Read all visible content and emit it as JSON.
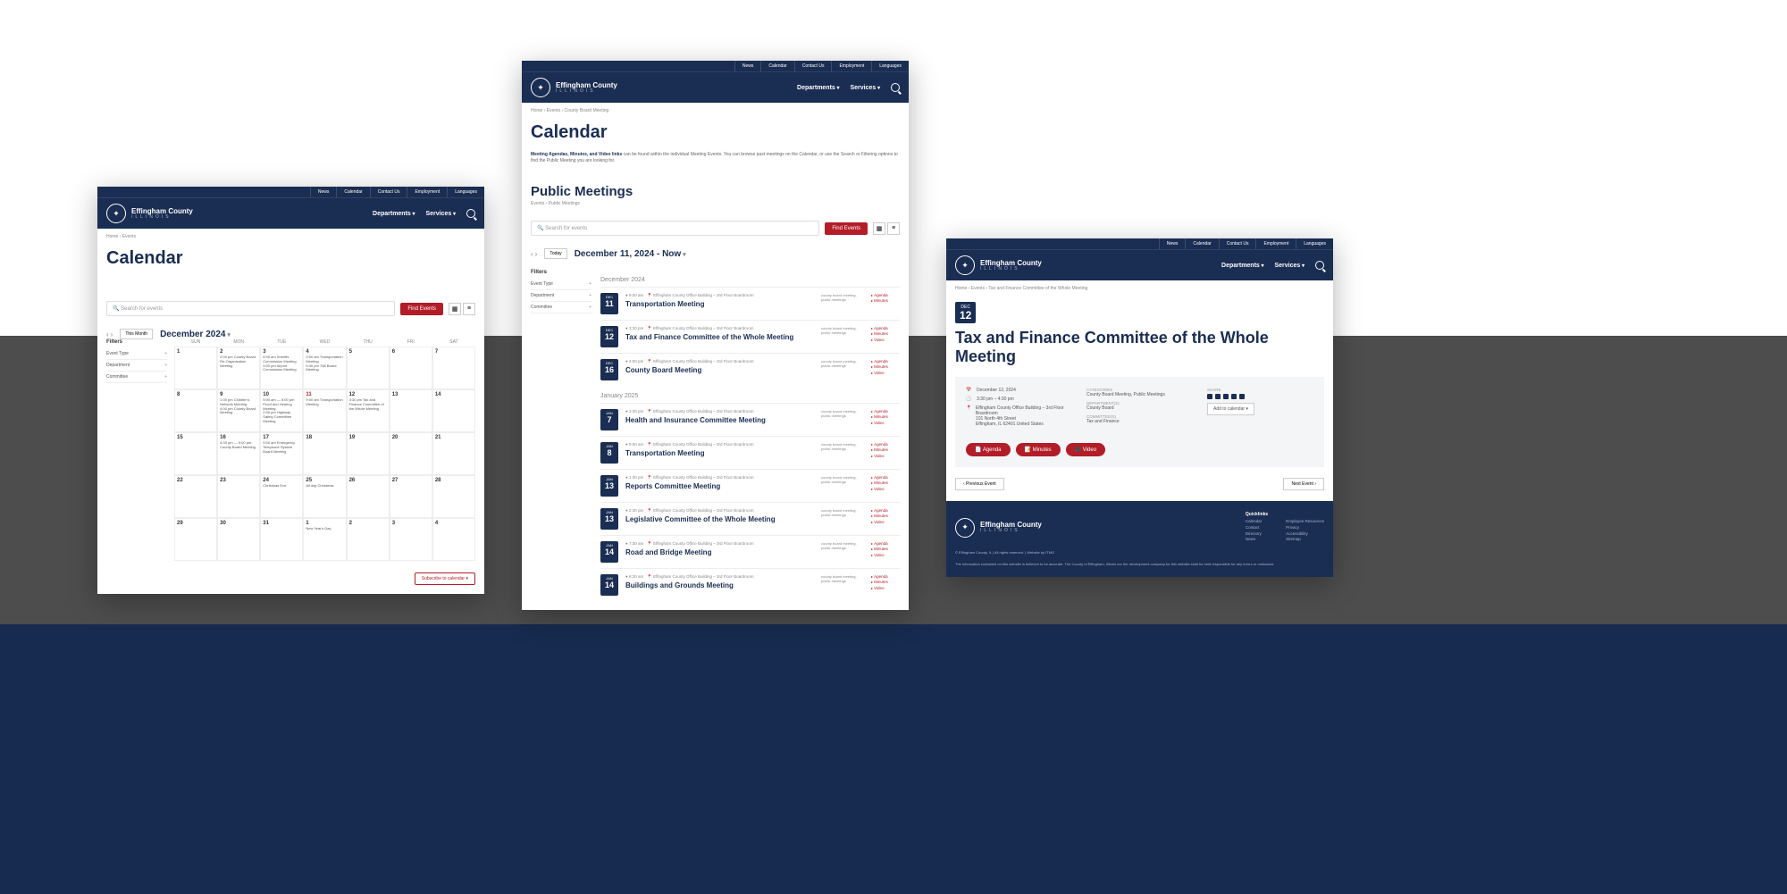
{
  "common": {
    "brand": "Effingham County",
    "brandSub": "ILLINOIS",
    "topnav": {
      "news": "News",
      "calendar": "Calendar",
      "contact": "Contact Us",
      "employment": "Employment",
      "languages": "Languages"
    },
    "mainnav": {
      "departments": "Departments",
      "services": "Services"
    },
    "findEvents": "Find Events",
    "searchPlaceholder": "Search for events",
    "filters": {
      "title": "Filters",
      "eventType": "Event Type",
      "department": "Department",
      "committee": "Committee"
    },
    "subscribe": "Subscribe to calendar ▾",
    "today": "Today",
    "thisMonth": "This Month"
  },
  "shot1": {
    "crumbs": "Home › Events",
    "title": "Calendar",
    "month": "December 2024",
    "dows": [
      "SUN",
      "MON",
      "TUE",
      "WED",
      "THU",
      "FRI",
      "SAT"
    ],
    "cells": [
      {
        "n": "1"
      },
      {
        "n": "2",
        "t": "2:00 pm County Board Re-Organization Meeting"
      },
      {
        "n": "3",
        "t": "9:00 am Sheriffs Commission Meeting\n9:00 pm Airport Commission Meeting"
      },
      {
        "n": "4",
        "t": "9:00 am Transportation Meeting\n5:30 pm 708 Board Meeting"
      },
      {
        "n": "5"
      },
      {
        "n": "6"
      },
      {
        "n": "7"
      },
      {
        "n": "8"
      },
      {
        "n": "9",
        "t": "1:00 pm Children's Network Meeting\n4:00 pm County Board Meeting"
      },
      {
        "n": "10",
        "t": "9:00 am — 5:00 pm Proof and Hearing Meeting\n2:00 pm Highway Safety Committee Meeting"
      },
      {
        "n": "11",
        "t": "9:00 am Transportation Meeting",
        "today": true
      },
      {
        "n": "12",
        "t": "3:30 pm Tax and Finance Committee of the Whole Meeting"
      },
      {
        "n": "13"
      },
      {
        "n": "14"
      },
      {
        "n": "15"
      },
      {
        "n": "16",
        "t": "4:00 pm — 9:00 pm County Board Meeting"
      },
      {
        "n": "17",
        "t": "9:00 am Emergency Telephone System Board Meeting"
      },
      {
        "n": "18"
      },
      {
        "n": "19"
      },
      {
        "n": "20"
      },
      {
        "n": "21"
      },
      {
        "n": "22"
      },
      {
        "n": "23"
      },
      {
        "n": "24",
        "t": "Christmas Eve"
      },
      {
        "n": "25",
        "t": "All day Christmas"
      },
      {
        "n": "26"
      },
      {
        "n": "27"
      },
      {
        "n": "28"
      },
      {
        "n": "29"
      },
      {
        "n": "30"
      },
      {
        "n": "31"
      },
      {
        "n": "1",
        "t": "New Year's Day"
      },
      {
        "n": "2"
      },
      {
        "n": "3"
      },
      {
        "n": "4"
      }
    ]
  },
  "shot2": {
    "crumbs": "Home › Events › County Board Meeting",
    "title": "Calendar",
    "desc": "Meeting Agendas, Minutes, and Video links can be found within the individual Meeting Events. You can browse past meetings on the Calendar, or use the Search or Filtering options to find the Public Meeting you are looking for.",
    "descBold": "Meeting Agendas, Minutes, and Video links",
    "section": "Public Meetings",
    "sectionSub": "Events › Public Meetings",
    "dateRange": "December 11, 2024 - Now",
    "months": {
      "dec": "December 2024",
      "jan": "January 2025"
    },
    "events": [
      {
        "mon": "DEC",
        "day": "11",
        "time": "9:00 am",
        "loc": "Effingham County Office Building – 3rd Floor Boardroom",
        "title": "Transportation Meeting",
        "tags": "county board meeting, public meetings",
        "links": [
          "Agenda",
          "Minutes"
        ]
      },
      {
        "mon": "DEC",
        "day": "12",
        "time": "3:30 pm",
        "loc": "Effingham County Office Building – 3rd Floor Boardroom",
        "title": "Tax and Finance Committee of the Whole Meeting",
        "tags": "county board meeting, public meetings",
        "links": [
          "Agenda",
          "Minutes",
          "Video"
        ]
      },
      {
        "mon": "DEC",
        "day": "16",
        "time": "4:00 pm",
        "loc": "Effingham County Office Building – 3rd Floor Boardroom",
        "title": "County Board Meeting",
        "tags": "county board meeting, public meetings",
        "links": [
          "Agenda",
          "Minutes",
          "Video"
        ]
      },
      {
        "mon": "JAN",
        "day": "7",
        "time": "3:30 pm",
        "loc": "Effingham County Office Building – 3rd Floor Boardroom",
        "title": "Health and Insurance Committee Meeting",
        "tags": "county board meeting, public meetings",
        "links": [
          "Agenda",
          "Minutes",
          "Video"
        ]
      },
      {
        "mon": "JAN",
        "day": "8",
        "time": "9:00 am",
        "loc": "Effingham County Office Building – 3rd Floor Boardroom",
        "title": "Transportation Meeting",
        "tags": "county board meeting, public meetings",
        "links": [
          "Agenda",
          "Minutes",
          "Video"
        ]
      },
      {
        "mon": "JAN",
        "day": "13",
        "time": "1:30 pm",
        "loc": "Effingham County Office Building – 3rd Floor Boardroom",
        "title": "Reports Committee Meeting",
        "tags": "county board meeting, public meetings",
        "links": [
          "Agenda",
          "Minutes",
          "Video"
        ]
      },
      {
        "mon": "JAN",
        "day": "13",
        "time": "2:30 pm",
        "loc": "Effingham County Office Building – 3rd Floor Boardroom",
        "title": "Legislative Committee of the Whole Meeting",
        "tags": "county board meeting, public meetings",
        "links": [
          "Agenda",
          "Minutes",
          "Video"
        ]
      },
      {
        "mon": "JAN",
        "day": "14",
        "time": "7:30 am",
        "loc": "Effingham County Office Building – 3rd Floor Boardroom",
        "title": "Road and Bridge Meeting",
        "tags": "county board meeting, public meetings",
        "links": [
          "Agenda",
          "Minutes",
          "Video"
        ]
      },
      {
        "mon": "JAN",
        "day": "14",
        "time": "8:30 am",
        "loc": "Effingham County Office Building – 3rd Floor Boardroom",
        "title": "Buildings and Grounds Meeting",
        "tags": "county board meeting, public meetings",
        "links": [
          "Agenda",
          "Minutes",
          "Video"
        ]
      }
    ]
  },
  "shot3": {
    "crumbs": "Home › Events › Tax and Finance Committee of the Whole Meeting",
    "heroMon": "DEC",
    "heroDay": "12",
    "title": "Tax and Finance Committee of the Whole Meeting",
    "when": "December 12, 2024",
    "time": "3:30 pm – 4:30 pm",
    "addr": "Effingham County Office Building – 3rd Floor Boardroom\n101 North 4th Street\nEffingham, IL 62401 United States",
    "labels": {
      "categories": "CATEGORIES",
      "departments": "DEPARTMENT(S)",
      "committees": "COMMITTEE(S)",
      "share": "SHARE"
    },
    "categories": "County Board Meeting, Public Meetings",
    "departments": "County Board",
    "committees": "Tax and Finance",
    "addCal": "Add to calendar ▾",
    "pills": {
      "agenda": "Agenda",
      "minutes": "Minutes",
      "video": "Video"
    },
    "prev": "‹ Previous Event",
    "next": "Next Event ›",
    "footer": {
      "copyright": "© Effingham County, IL | All rights reserved. | Website by ITMG",
      "disclaimer": "The information contained on this website is believed to be accurate. The County of Effingham, Illinois nor the development company for this website shall be held responsible for any errors or omissions.",
      "ql": "Quicklinks",
      "links1": [
        "Calendar",
        "Contact",
        "Directory",
        "News"
      ],
      "links2": [
        "Employee Resources",
        "Privacy",
        "Accessibility",
        "Sitemap"
      ]
    }
  }
}
